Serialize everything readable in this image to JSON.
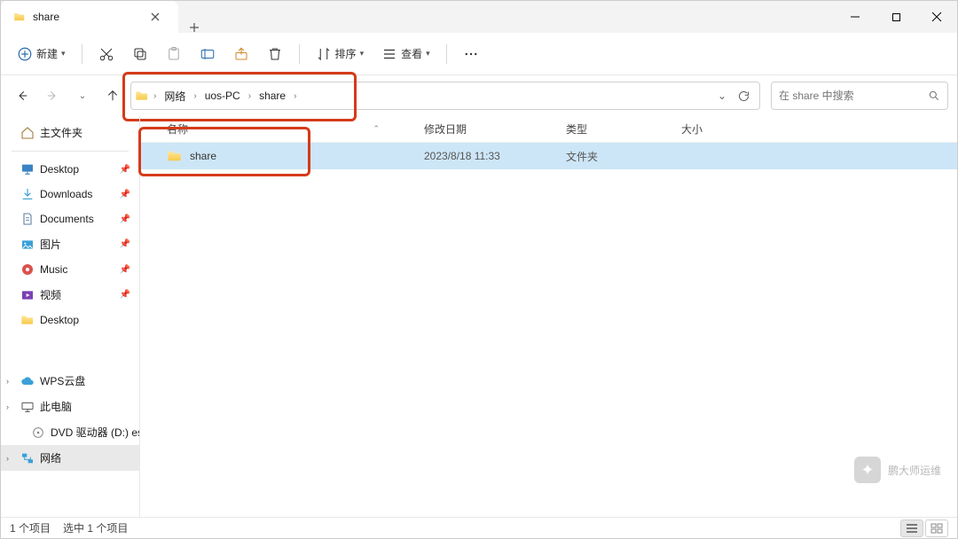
{
  "window": {
    "tab_title": "share",
    "minimize": "–",
    "maximize": "▢",
    "close": "✕"
  },
  "toolbar": {
    "new_label": "新建",
    "sort_label": "排序",
    "view_label": "查看"
  },
  "nav": {
    "breadcrumbs": {
      "seg0": "网络",
      "seg1": "uos-PC",
      "seg2": "share"
    },
    "search_placeholder": "在 share 中搜索"
  },
  "sidebar": {
    "home": "主文件夹",
    "pinned": {
      "desktop1": "Desktop",
      "downloads": "Downloads",
      "documents": "Documents",
      "pictures": "图片",
      "music": "Music",
      "videos": "视频",
      "desktop2": "Desktop"
    },
    "wps": "WPS云盘",
    "thispc": "此电脑",
    "dvd": "DVD 驱动器 (D:) es",
    "network": "网络"
  },
  "columns": {
    "name": "名称",
    "date": "修改日期",
    "type": "类型",
    "size": "大小"
  },
  "files": [
    {
      "name": "share",
      "date": "2023/8/18 11:33",
      "type": "文件夹",
      "size": ""
    }
  ],
  "status": {
    "count": "1 个项目",
    "selection": "选中 1 个项目"
  },
  "watermark": "鹏大师运维"
}
